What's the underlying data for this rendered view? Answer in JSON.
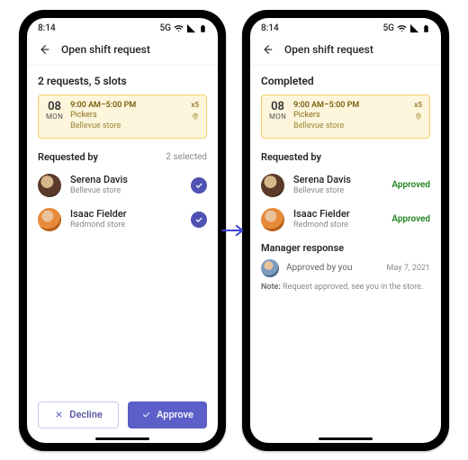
{
  "left": {
    "status": {
      "time": "8:14",
      "net": "5G"
    },
    "header": {
      "title": "Open shift request"
    },
    "summary": "2 requests, 5 slots",
    "shift": {
      "daynum": "08",
      "dayname": "MON",
      "time": "9:00 AM–5:00 PM",
      "count": "x5",
      "role": "Pickers",
      "location": "Bellevue store"
    },
    "requested_by_label": "Requested by",
    "selected_meta": "2 selected",
    "people": [
      {
        "name": "Serena Davis",
        "loc": "Bellevue store"
      },
      {
        "name": "Isaac Fielder",
        "loc": "Redmond store"
      }
    ],
    "buttons": {
      "decline": "Decline",
      "approve": "Approve"
    }
  },
  "right": {
    "status": {
      "time": "8:14",
      "net": "5G"
    },
    "header": {
      "title": "Open shift request"
    },
    "summary": "Completed",
    "shift": {
      "daynum": "08",
      "dayname": "MON",
      "time": "9:00 AM–5:00 PM",
      "count": "x5",
      "role": "Pickers",
      "location": "Bellevue store"
    },
    "requested_by_label": "Requested by",
    "people": [
      {
        "name": "Serena Davis",
        "loc": "Bellevue store",
        "status": "Approved"
      },
      {
        "name": "Isaac Fielder",
        "loc": "Redmond store",
        "status": "Approved"
      }
    ],
    "manager": {
      "label": "Manager response",
      "text": "Approved by you",
      "date": "May 7, 2021",
      "note_prefix": "Note:",
      "note": "Request approved, see you in the store."
    }
  }
}
